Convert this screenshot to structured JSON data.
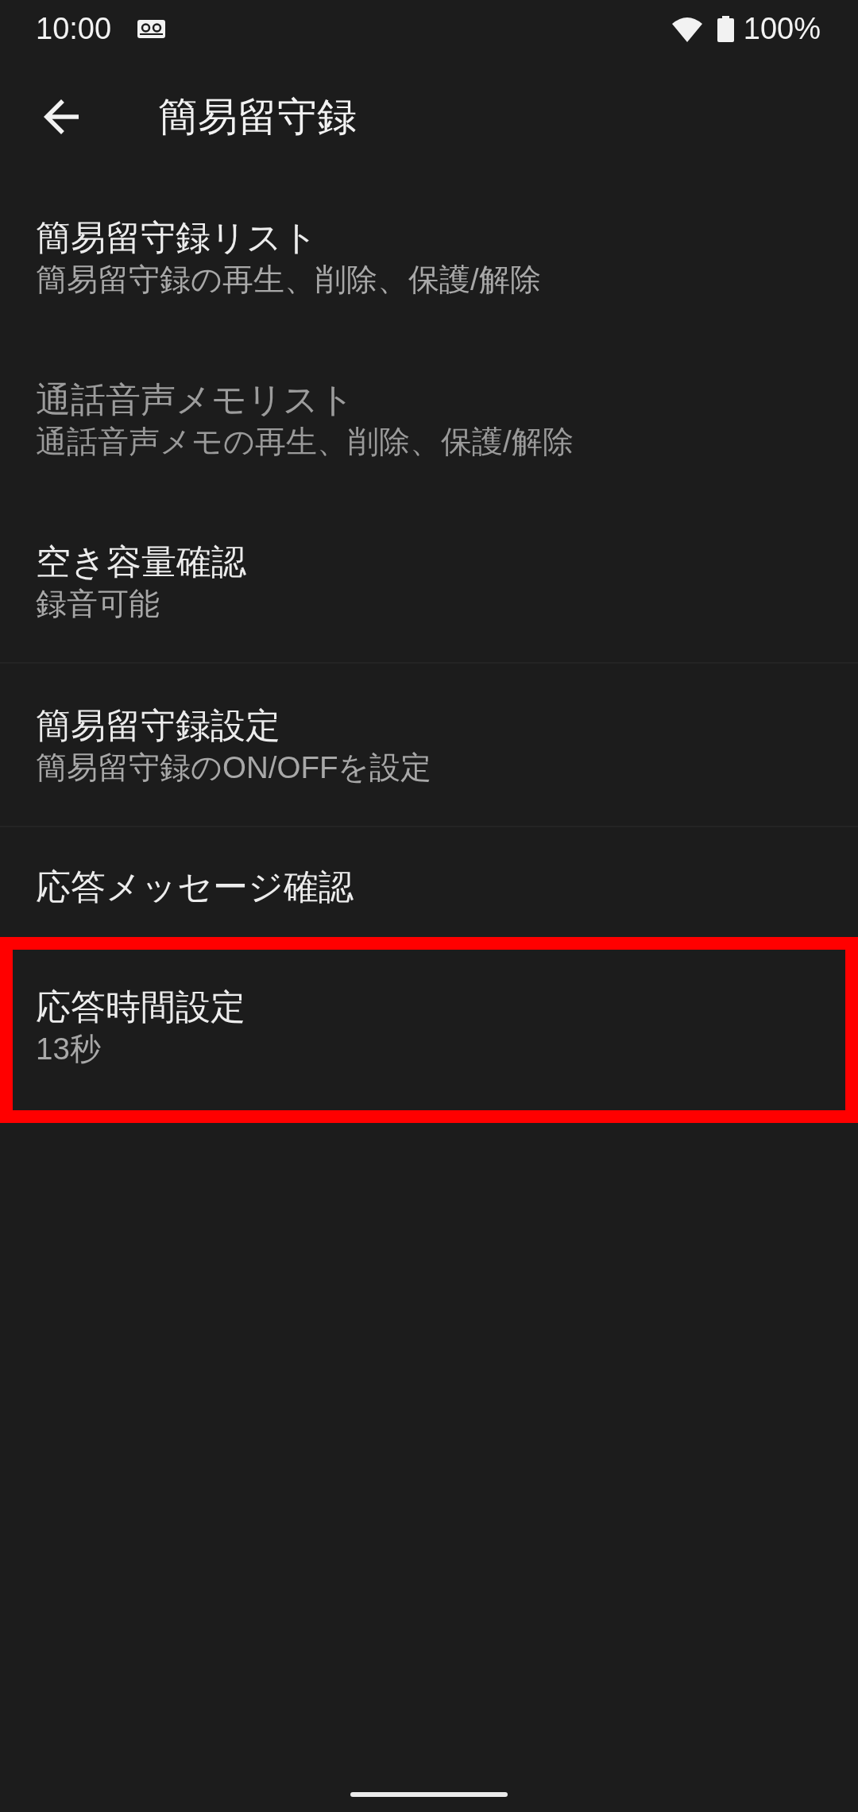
{
  "status_bar": {
    "time": "10:00",
    "battery": "100%"
  },
  "app_bar": {
    "title": "簡易留守録"
  },
  "sections": [
    {
      "items": [
        {
          "title": "簡易留守録リスト",
          "summary": "簡易留守録の再生、削除、保護/解除",
          "disabled": false,
          "highlighted": false
        },
        {
          "title": "通話音声メモリスト",
          "summary": "通話音声メモの再生、削除、保護/解除",
          "disabled": true,
          "highlighted": false
        },
        {
          "title": "空き容量確認",
          "summary": "録音可能",
          "disabled": false,
          "highlighted": false
        }
      ]
    },
    {
      "items": [
        {
          "title": "簡易留守録設定",
          "summary": "簡易留守録のON/OFFを設定",
          "disabled": false,
          "highlighted": false
        }
      ]
    },
    {
      "items": [
        {
          "title": "応答メッセージ確認",
          "disabled": false,
          "highlighted": false
        },
        {
          "title": "応答時間設定",
          "summary": "13秒",
          "disabled": false,
          "highlighted": true
        }
      ]
    }
  ]
}
